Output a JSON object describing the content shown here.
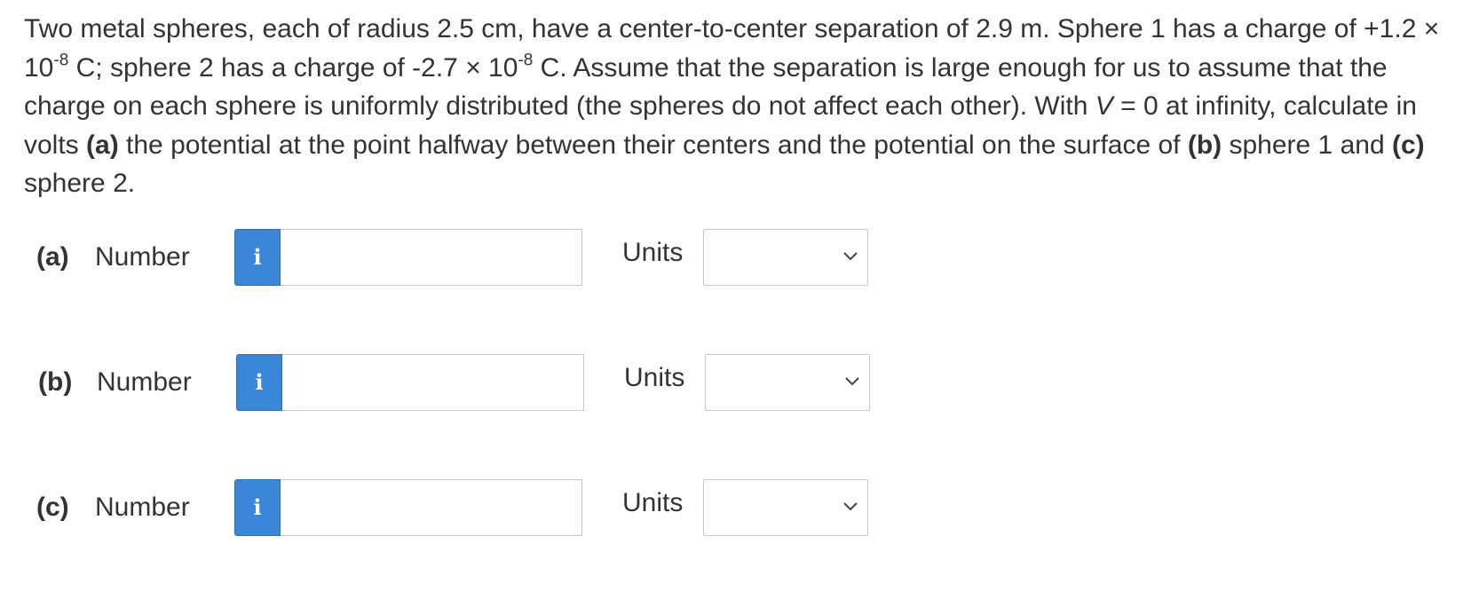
{
  "problem": {
    "t1": "Two metal spheres, each of radius 2.5 cm, have a center-to-center separation of 2.9 m. Sphere 1 has a charge of +1.2 × 10",
    "exp1": "-8",
    "t2": " C; sphere 2 has a charge of -2.7 × 10",
    "exp2": "-8",
    "t3": " C. Assume that the separation is large enough for us to assume that the charge on each sphere is uniformly distributed (the spheres do not affect each other). With ",
    "v_symbol": "V",
    "t4": " = 0 at infinity, calculate in volts ",
    "part_a": "(a)",
    "t5": " the potential at the point halfway between their centers and the potential on the surface of ",
    "part_b": "(b)",
    "t6": " sphere 1 and ",
    "part_c": "(c)",
    "t7": " sphere 2."
  },
  "answers": [
    {
      "part": "(a)",
      "number_label": "Number",
      "info_icon": "i",
      "value": "",
      "units_label": "Units",
      "units_value": ""
    },
    {
      "part": "(b)",
      "number_label": "Number",
      "info_icon": "i",
      "value": "",
      "units_label": "Units",
      "units_value": ""
    },
    {
      "part": "(c)",
      "number_label": "Number",
      "info_icon": "i",
      "value": "",
      "units_label": "Units",
      "units_value": ""
    }
  ],
  "colors": {
    "info_button": "#3a86d9",
    "text": "#333333",
    "border": "#c6c6c6"
  },
  "icons": {
    "info": "info-icon",
    "dropdown": "chevron-down-icon"
  }
}
